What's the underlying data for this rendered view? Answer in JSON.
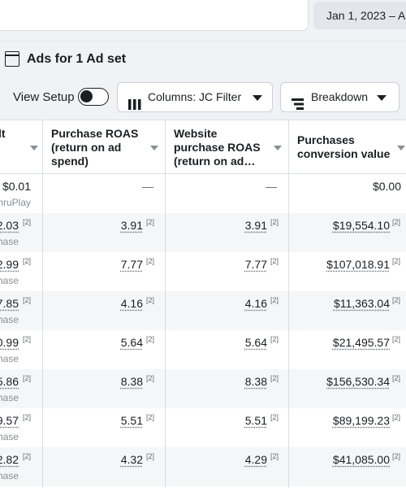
{
  "topbar": {
    "date_range": "Jan 1, 2023 – Ap"
  },
  "adset_header": {
    "title": "Ads for 1 Ad set"
  },
  "toolbar": {
    "view_setup_label": "View Setup",
    "view_setup_on": false,
    "columns_label": "Columns: JC Filter",
    "breakdown_label": "Breakdown"
  },
  "table": {
    "headers": [
      "lt",
      "Purchase ROAS (return on ad spend)",
      "Website purchase ROAS (return on ad…",
      "Purchases conversion value"
    ],
    "summary_row": {
      "c0": "$0.01",
      "c0_sub": "hruPlay",
      "c1": "—",
      "c2": "—",
      "c3": "$0.00"
    },
    "rows": [
      {
        "c0": "2.03",
        "c0_sub": "hase",
        "c1": "3.91",
        "c2": "3.91",
        "c3": "$19,554.10"
      },
      {
        "c0": "2.99",
        "c0_sub": "hase",
        "c1": "7.77",
        "c2": "7.77",
        "c3": "$107,018.91"
      },
      {
        "c0": "7.85",
        "c0_sub": "hase",
        "c1": "4.16",
        "c2": "4.16",
        "c3": "$11,363.04"
      },
      {
        "c0": "0.99",
        "c0_sub": "hase",
        "c1": "5.64",
        "c2": "5.64",
        "c3": "$21,495.57"
      },
      {
        "c0": "5.86",
        "c0_sub": "hase",
        "c1": "8.38",
        "c2": "8.38",
        "c3": "$156,530.34"
      },
      {
        "c0": "9.57",
        "c0_sub": "hase",
        "c1": "5.51",
        "c2": "5.51",
        "c3": "$89,199.23"
      },
      {
        "c0": "2.82",
        "c0_sub": "hase",
        "c1": "4.32",
        "c2": "4.29",
        "c3": "$41,085.00"
      }
    ],
    "ref_marker": "[2]"
  }
}
